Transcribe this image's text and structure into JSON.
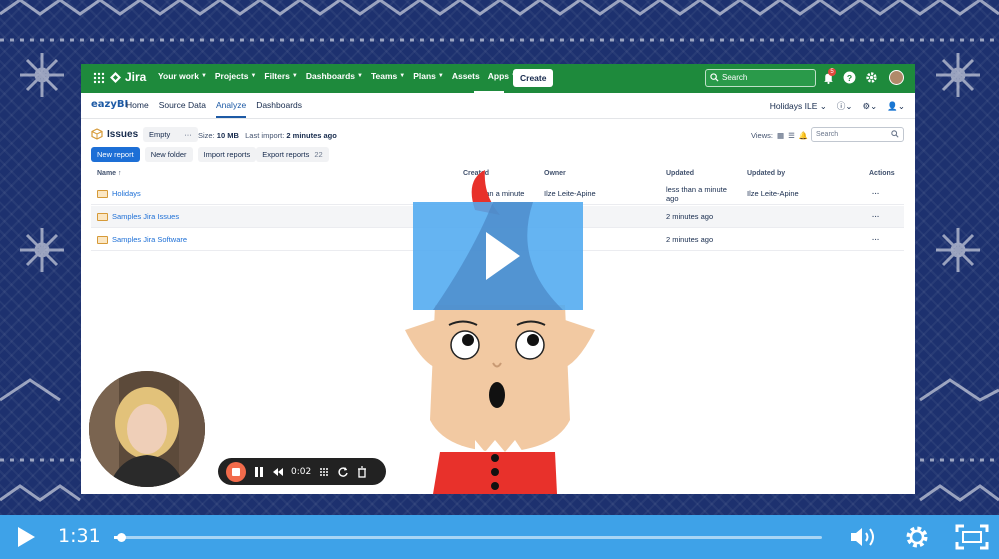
{
  "jira": {
    "brand": "Jira",
    "nav": [
      "Your work",
      "Projects",
      "Filters",
      "Dashboards",
      "Teams",
      "Plans",
      "Assets",
      "Apps"
    ],
    "create_label": "Create",
    "search_placeholder": "Search",
    "notification_count": "5"
  },
  "easybi": {
    "logo": "eazyBI",
    "tabs": [
      "Home",
      "Source Data",
      "Analyze",
      "Dashboards"
    ],
    "active_tab": "Analyze",
    "account": "Holidays ILE"
  },
  "toolbar": {
    "title": "Issues",
    "empty_label": "Empty",
    "size_label": "Size:",
    "size_value": "10 MB",
    "last_import_label": "Last import:",
    "last_import_value": "2 minutes ago",
    "views_label": "Views:",
    "search_placeholder": "Search",
    "new_report": "New report",
    "new_folder": "New folder",
    "import_reports": "Import reports",
    "export_reports": "Export reports",
    "export_count": "22"
  },
  "table": {
    "headers": {
      "name": "Name ↑",
      "created": "Created",
      "owner": "Owner",
      "updated": "Updated",
      "updated_by": "Updated by",
      "actions": "Actions"
    },
    "rows": [
      {
        "name": "Holidays",
        "created": "than a minute",
        "owner": "Ilze Leite-Apine",
        "updated": "less than a minute ago",
        "updated_by": "Ilze Leite-Apine",
        "actions": "···"
      },
      {
        "name": "Samples Jira Issues",
        "created": "",
        "owner": "",
        "updated": "2 minutes ago",
        "updated_by": "",
        "actions": "···"
      },
      {
        "name": "Samples Jira Software",
        "created": "",
        "owner": "",
        "updated": "2 minutes ago",
        "updated_by": "",
        "actions": "···"
      }
    ]
  },
  "recorder": {
    "time": "0:02"
  },
  "player": {
    "time": "1:31",
    "progress": 0.01
  },
  "colors": {
    "jira_green": "#1e8a3c",
    "player_blue": "#3ea2e8",
    "background_navy": "#1d316f",
    "record_red": "#f26b4b"
  }
}
